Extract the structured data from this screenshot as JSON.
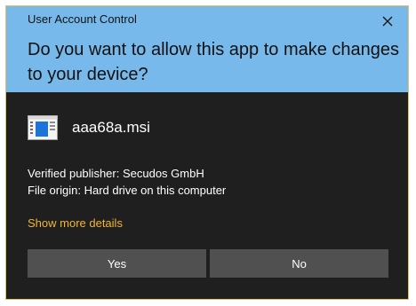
{
  "dialog": {
    "title": "User Account Control",
    "question": "Do you want to allow this app to make changes to your device?",
    "close_icon": "close-icon"
  },
  "app": {
    "icon": "installer-file-icon",
    "name": "aaa68a.msi"
  },
  "info": {
    "publisher": "Verified publisher: Secudos GmbH",
    "origin": "File origin: Hard drive on this computer"
  },
  "details_link": "Show more details",
  "buttons": {
    "yes": "Yes",
    "no": "No"
  },
  "colors": {
    "header_bg": "#78b9eb",
    "body_bg": "#1f1f1f",
    "border": "#e3c06a",
    "link": "#f2b632",
    "button_bg": "#505050"
  }
}
